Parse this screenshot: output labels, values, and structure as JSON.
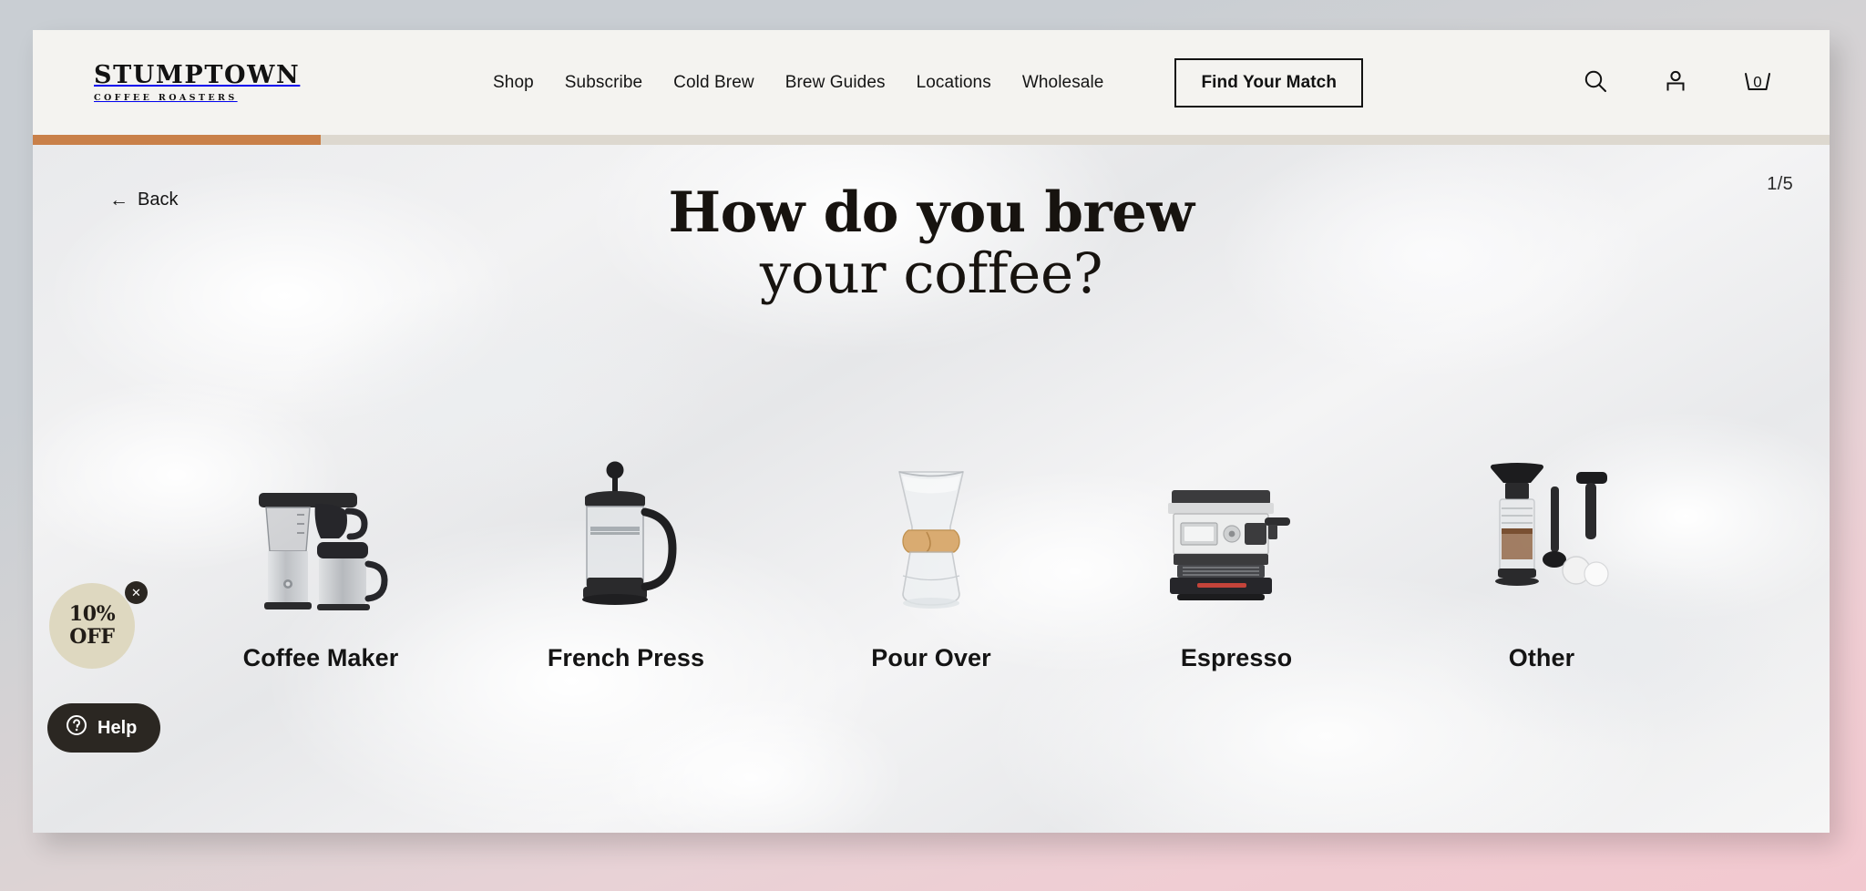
{
  "brand": {
    "name": "STUMPTOWN",
    "tagline": "COFFEE ROASTERS"
  },
  "header": {
    "nav": [
      {
        "label": "Shop",
        "name": "nav-shop"
      },
      {
        "label": "Subscribe",
        "name": "nav-subscribe"
      },
      {
        "label": "Cold Brew",
        "name": "nav-cold-brew"
      },
      {
        "label": "Brew Guides",
        "name": "nav-brew-guides"
      },
      {
        "label": "Locations",
        "name": "nav-locations"
      },
      {
        "label": "Wholesale",
        "name": "nav-wholesale"
      }
    ],
    "cta_label": "Find Your Match",
    "icons": {
      "search": "search-icon",
      "account": "account-icon",
      "cart": "cart-icon"
    },
    "cart_count": "0"
  },
  "progress": {
    "percent": 16,
    "fill_color": "#c98049",
    "track_color": "#ddd8cf"
  },
  "quiz": {
    "back_label": "Back",
    "back_arrow": "←",
    "step_counter": "1/5",
    "title_line1": "How do you brew",
    "title_line2": "your coffee?",
    "options": [
      {
        "label": "Coffee Maker",
        "name": "option-coffee-maker",
        "art": "coffee-maker-image"
      },
      {
        "label": "French Press",
        "name": "option-french-press",
        "art": "french-press-image"
      },
      {
        "label": "Pour Over",
        "name": "option-pour-over",
        "art": "pour-over-image"
      },
      {
        "label": "Espresso",
        "name": "option-espresso",
        "art": "espresso-machine-image"
      },
      {
        "label": "Other",
        "name": "option-other",
        "art": "aeropress-image"
      }
    ]
  },
  "promo": {
    "line1": "10%",
    "line2": "OFF",
    "close_glyph": "✕",
    "badge_color": "#ded8c0"
  },
  "help": {
    "label": "Help",
    "icon": "question-mark-icon"
  }
}
